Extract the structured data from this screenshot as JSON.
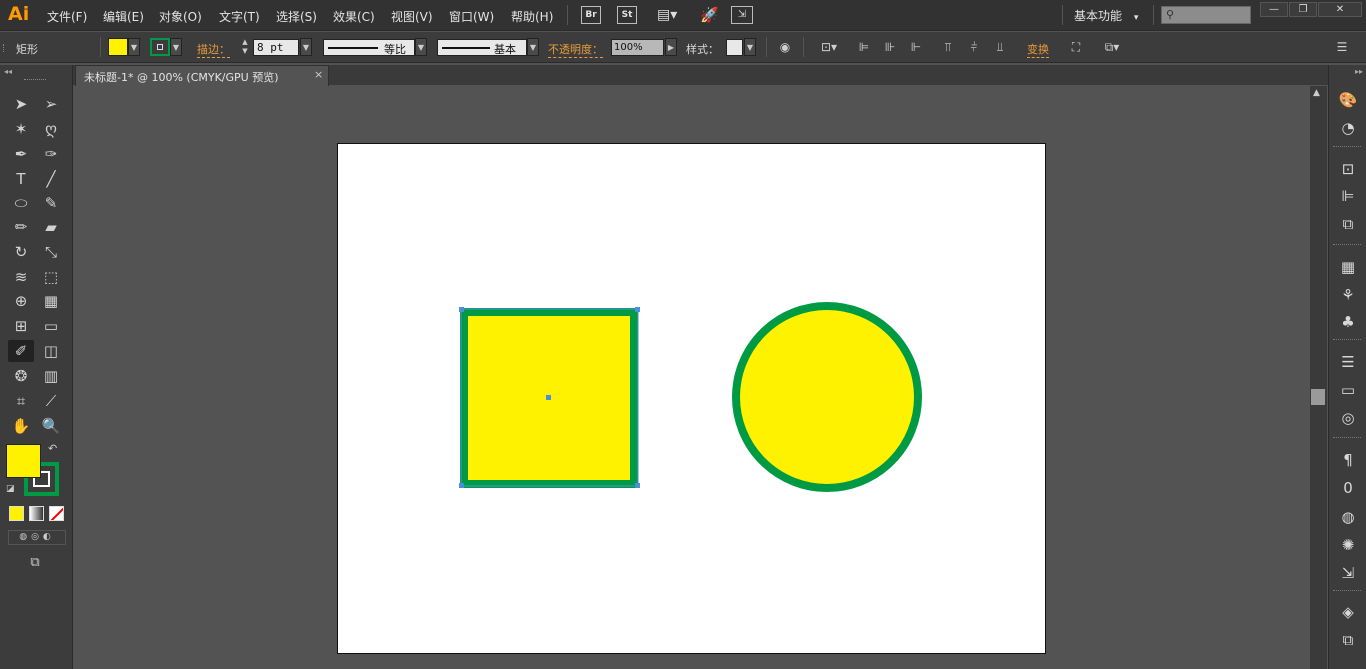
{
  "app": {
    "logo": "Ai"
  },
  "menu": [
    "文件(F)",
    "编辑(E)",
    "对象(O)",
    "文字(T)",
    "选择(S)",
    "效果(C)",
    "视图(V)",
    "窗口(W)",
    "帮助(H)"
  ],
  "menubar_icons": {
    "bridge": "Br",
    "stock": "St"
  },
  "workspace": {
    "label": "基本功能",
    "arrow": "▾"
  },
  "window_controls": {
    "minimize": "—",
    "restore": "❐",
    "close": "✕"
  },
  "control": {
    "object_type": "矩形",
    "stroke_label": "描边：",
    "stroke_weight": "8 pt",
    "stroke_profile": "等比",
    "brush": "基本",
    "opacity_label": "不透明度：",
    "opacity_value": "100%",
    "style_label": "样式：",
    "transform_label": "变换",
    "fill_color": "#fff200",
    "stroke_color": "#009a44"
  },
  "document_tab": {
    "title": "未标题-1* @ 100% (CMYK/GPU 预览)",
    "close": "×"
  },
  "colors": {
    "fill": "#fff200",
    "stroke": "#009a44",
    "selection": "#4a90d9"
  },
  "tools": [
    {
      "name": "selection-tool-icon",
      "glyph": "➤"
    },
    {
      "name": "direct-selection-tool-icon",
      "glyph": "➢"
    },
    {
      "name": "magic-wand-tool-icon",
      "glyph": "✶"
    },
    {
      "name": "lasso-tool-icon",
      "glyph": "ღ"
    },
    {
      "name": "pen-tool-icon",
      "glyph": "✒"
    },
    {
      "name": "curvature-tool-icon",
      "glyph": "✑"
    },
    {
      "name": "type-tool-icon",
      "glyph": "T"
    },
    {
      "name": "line-tool-icon",
      "glyph": "╱"
    },
    {
      "name": "ellipse-tool-icon",
      "glyph": "⬭"
    },
    {
      "name": "paintbrush-tool-icon",
      "glyph": "✎"
    },
    {
      "name": "pencil-tool-icon",
      "glyph": "✏"
    },
    {
      "name": "eraser-tool-icon",
      "glyph": "▰"
    },
    {
      "name": "rotate-tool-icon",
      "glyph": "↻"
    },
    {
      "name": "scale-tool-icon",
      "glyph": "⤡"
    },
    {
      "name": "width-tool-icon",
      "glyph": "≋"
    },
    {
      "name": "free-transform-tool-icon",
      "glyph": "⬚"
    },
    {
      "name": "shape-builder-tool-icon",
      "glyph": "⊕"
    },
    {
      "name": "perspective-grid-tool-icon",
      "glyph": "▦"
    },
    {
      "name": "mesh-tool-icon",
      "glyph": "⊞"
    },
    {
      "name": "gradient-tool-icon",
      "glyph": "▭"
    },
    {
      "name": "eyedropper-tool-icon",
      "glyph": "✐"
    },
    {
      "name": "blend-tool-icon",
      "glyph": "◫"
    },
    {
      "name": "symbol-sprayer-tool-icon",
      "glyph": "❂"
    },
    {
      "name": "column-graph-tool-icon",
      "glyph": "▥"
    },
    {
      "name": "artboard-tool-icon",
      "glyph": "⌗"
    },
    {
      "name": "slice-tool-icon",
      "glyph": "⟋"
    },
    {
      "name": "hand-tool-icon",
      "glyph": "✋"
    },
    {
      "name": "zoom-tool-icon",
      "glyph": "🔍"
    }
  ],
  "panels": [
    "color-panel-icon",
    "color-guide-panel-icon",
    "transform-panel-icon",
    "align-panel-icon",
    "pathfinder-panel-icon",
    "swatches-panel-icon",
    "brushes-panel-icon",
    "symbols-panel-icon",
    "stroke-panel-icon",
    "gradient-panel-icon",
    "transparency-panel-icon",
    "paragraph-panel-icon",
    "opentype-panel-icon",
    "libraries-panel-icon",
    "appearance-panel-icon",
    "asset-export-panel-icon",
    "layers-panel-icon",
    "artboards-panel-icon"
  ]
}
